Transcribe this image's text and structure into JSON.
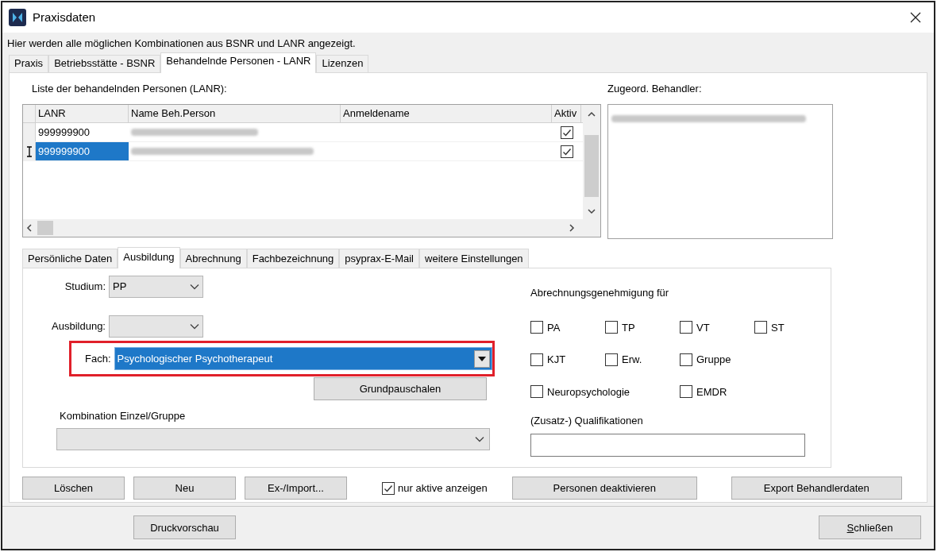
{
  "window": {
    "title": "Praxisdaten"
  },
  "info": "Hier werden alle möglichen Kombinationen aus BSNR und LANR angezeigt.",
  "tabs": [
    {
      "label": "Praxis",
      "selected": false
    },
    {
      "label": "Betriebsstätte - BSNR",
      "selected": false
    },
    {
      "label": "Behandelnde Personen - LANR",
      "selected": true
    },
    {
      "label": "Lizenzen",
      "selected": false
    }
  ],
  "persons": {
    "label": "Liste der behandelnden Personen (LANR):",
    "columns": [
      "LANR",
      "Name Beh.Person",
      "Anmeldename",
      "Aktiv"
    ],
    "rows": [
      {
        "lanr": "999999900",
        "selected": false,
        "aktiv": true
      },
      {
        "lanr": "999999900",
        "selected": true,
        "aktiv": true
      }
    ]
  },
  "assigned": {
    "label": "Zugeord. Behandler:"
  },
  "detail_tabs": [
    {
      "label": "Persönliche Daten",
      "selected": false
    },
    {
      "label": "Ausbildung",
      "selected": true
    },
    {
      "label": "Abrechnung",
      "selected": false
    },
    {
      "label": "Fachbezeichnung",
      "selected": false
    },
    {
      "label": "psyprax-E-Mail",
      "selected": false
    },
    {
      "label": "weitere Einstellungen",
      "selected": false
    }
  ],
  "studium": {
    "label": "Studium:",
    "value": "PP"
  },
  "ausbildung": {
    "label": "Ausbildung:"
  },
  "fach": {
    "label": "Fach:",
    "value": "Psychologischer Psychotherapeut",
    "highlighted": true
  },
  "grundpauschalen": "Grundpauschalen",
  "kombination": {
    "label": "Kombination Einzel/Gruppe",
    "disabled": true
  },
  "approval": {
    "label": "Abrechnungsgenehmigung für",
    "rows": [
      [
        {
          "label": "PA",
          "checked": false
        },
        {
          "label": "TP",
          "checked": false
        },
        {
          "label": "VT",
          "checked": false
        },
        {
          "label": "ST",
          "checked": false
        }
      ],
      [
        {
          "label": "KJT",
          "checked": false
        },
        {
          "label": "Erw.",
          "checked": false
        },
        {
          "label": "Gruppe",
          "checked": false
        }
      ],
      [
        {
          "label": "Neuropsychologie",
          "checked": false
        },
        "",
        {
          "label": "EMDR",
          "checked": false
        }
      ]
    ]
  },
  "qualifications": {
    "label": "(Zusatz-) Qualifikationen"
  },
  "actions": [
    {
      "kind": "button",
      "label": "Löschen"
    },
    {
      "kind": "button",
      "label": "Neu"
    },
    {
      "kind": "button",
      "label": "Ex-/Import..."
    },
    {
      "kind": "checkbox",
      "label": "nur aktive anzeigen",
      "checked": true
    },
    {
      "kind": "button",
      "label": "Personen deaktivieren"
    },
    {
      "kind": "button",
      "label": "Export Behandlerdaten"
    }
  ],
  "footer": [
    {
      "label": "Druckvorschau",
      "access_key": false
    },
    {
      "label": "Schließen",
      "access_key": true
    }
  ]
}
